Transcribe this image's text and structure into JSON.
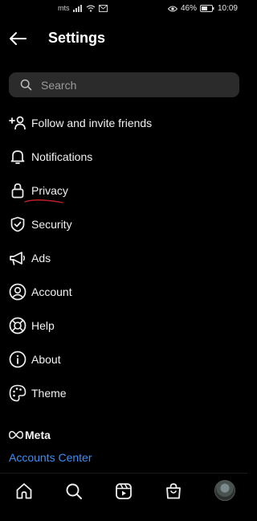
{
  "status_bar": {
    "carrier": "mts",
    "battery": "46%",
    "time": "10:09"
  },
  "header": {
    "title": "Settings"
  },
  "search": {
    "placeholder": "Search"
  },
  "menu": [
    {
      "label": "Follow and invite friends",
      "icon": "add-person-icon"
    },
    {
      "label": "Notifications",
      "icon": "bell-icon"
    },
    {
      "label": "Privacy",
      "icon": "lock-icon"
    },
    {
      "label": "Security",
      "icon": "shield-check-icon"
    },
    {
      "label": "Ads",
      "icon": "megaphone-icon"
    },
    {
      "label": "Account",
      "icon": "account-circle-icon"
    },
    {
      "label": "Help",
      "icon": "lifebuoy-icon"
    },
    {
      "label": "About",
      "icon": "info-icon"
    },
    {
      "label": "Theme",
      "icon": "palette-icon"
    }
  ],
  "footer": {
    "meta": "Meta",
    "accounts_center": "Accounts Center"
  },
  "bottom_nav": [
    "home-icon",
    "search-icon",
    "reels-icon",
    "shop-icon",
    "profile-avatar"
  ],
  "colors": {
    "background": "#000000",
    "link": "#3d8ef7",
    "annotation_underline": "#c0202a"
  }
}
